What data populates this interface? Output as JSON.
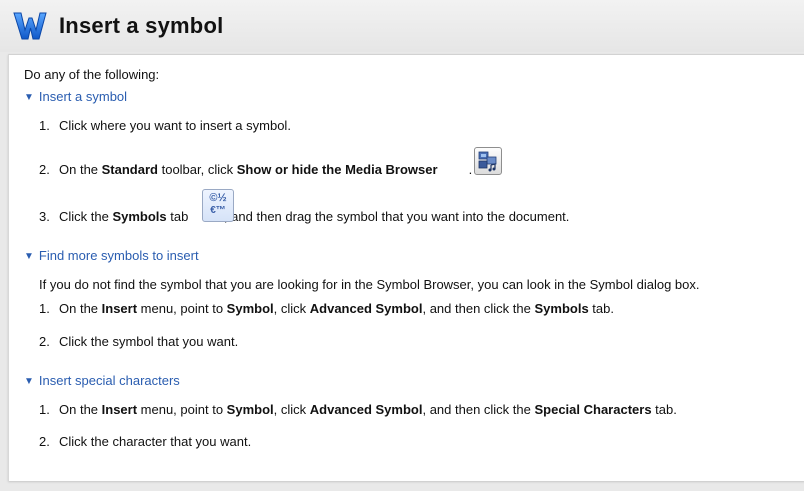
{
  "header": {
    "title": "Insert a symbol"
  },
  "intro": "Do any of the following:",
  "section1": {
    "title": "Insert a symbol",
    "step1": {
      "num": "1.",
      "text": "Click where you want to insert a symbol."
    },
    "step2": {
      "num": "2.",
      "pre": "On the ",
      "b1": "Standard",
      "mid": " toolbar, click ",
      "b2": "Show or hide the Media Browser",
      "post": "."
    },
    "step3": {
      "num": "3.",
      "pre": "Click the ",
      "b1": "Symbols",
      "mid": " tab ",
      "post": ", and then drag the symbol that you want into the document."
    }
  },
  "section2": {
    "title": "Find more symbols to insert",
    "intro": "If you do not find the symbol that you are looking for in the Symbol Browser, you can look in the Symbol dialog box.",
    "step1": {
      "num": "1.",
      "a": "On the ",
      "b": "Insert",
      "c": " menu, point to ",
      "d": "Symbol",
      "e": ", click ",
      "f": "Advanced Symbol",
      "g": ", and then click the ",
      "h": "Symbols",
      "i": " tab."
    },
    "step2": {
      "num": "2.",
      "text": "Click the symbol that you want."
    }
  },
  "section3": {
    "title": "Insert special characters",
    "step1": {
      "num": "1.",
      "a": "On the ",
      "b": "Insert",
      "c": " menu, point to ",
      "d": "Symbol",
      "e": ", click ",
      "f": "Advanced Symbol",
      "g": ", and then click the ",
      "h": "Special Characters",
      "i": " tab."
    },
    "step2": {
      "num": "2.",
      "text": "Click the character that you want."
    }
  },
  "icons": {
    "logo": "word-logo-icon",
    "media_browser": "media-browser-icon",
    "symbols_tab": "symbols-tab-icon",
    "triangle": "disclosure-triangle-icon"
  },
  "symbols_tab_glyphs": {
    "top": "©½",
    "bottom": "€™"
  },
  "colors": {
    "link": "#2a5db0",
    "logo": "#1e6fd9"
  }
}
